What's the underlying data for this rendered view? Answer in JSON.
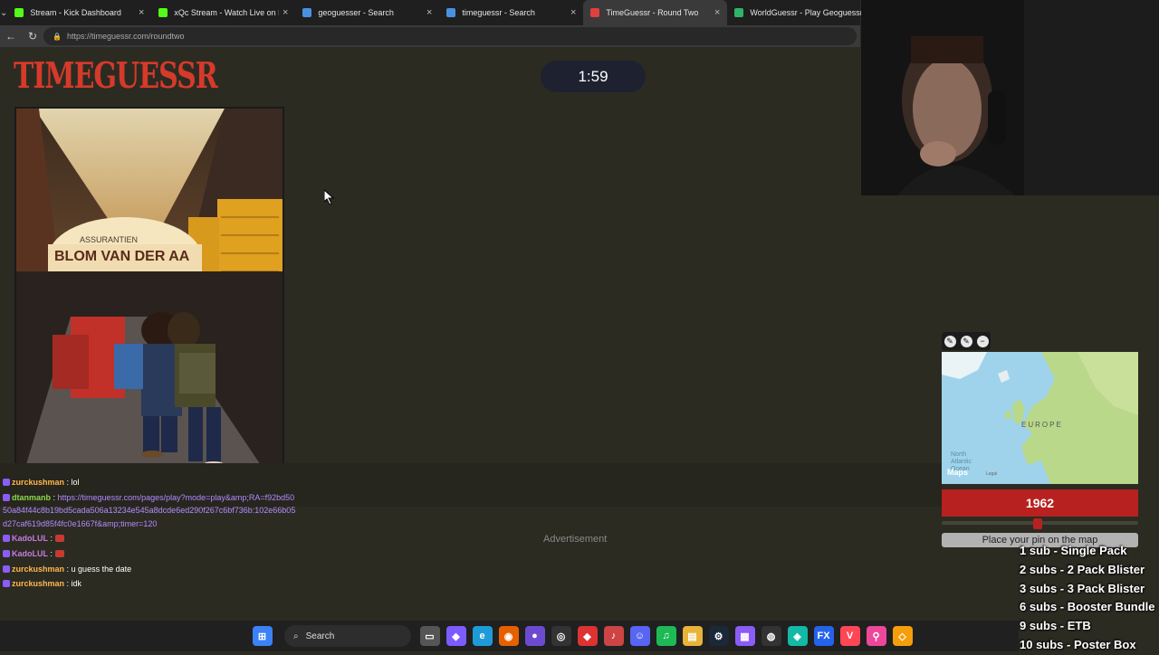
{
  "browser": {
    "tabs": [
      {
        "title": "Stream - Kick Dashboard",
        "favicon_color": "#53fc18"
      },
      {
        "title": "xQc Stream - Watch Live on Kick",
        "favicon_color": "#53fc18"
      },
      {
        "title": "geoguesser - Search",
        "favicon_color": "#4a90e2"
      },
      {
        "title": "timeguessr - Search",
        "favicon_color": "#4a90e2"
      },
      {
        "title": "TimeGuessr - Round Two",
        "favicon_color": "#e04040",
        "active": true
      },
      {
        "title": "WorldGuessr - Play Geoguessr f",
        "favicon_color": "#2fb36a"
      }
    ],
    "url": "https://timeguessr.com/roundtwo"
  },
  "game": {
    "logo": "TIMEGUESSR",
    "timer": "1:59",
    "photo_signs": [
      "ASSURANTIEN",
      "BLOM  VAN DER AA"
    ],
    "map": {
      "region_label": "EUROPE",
      "ocean_label": "North Atlantic Ocean",
      "brand": "Maps",
      "legal": "Legal",
      "tools": [
        "pencil-icon",
        "pencil-icon",
        "minus-icon"
      ]
    },
    "year": "1962",
    "slider_fraction": 0.49,
    "place_pin_text": "Place your pin on the map",
    "advertisement": "Advertisement"
  },
  "chat": [
    {
      "user": "zurckushman",
      "text": "lol",
      "color": "orange"
    },
    {
      "user": "dtanmanb",
      "link": "https://timeguessr.com/pages/play?mode=play&amp;RA=f92bd5050a84f44c8b19bd5cada506a13234e545a8dcde6ed290f267c6bf736b:102e66b05d27caf619d85f4fc0e1667f&amp;timer=120",
      "color": "green"
    },
    {
      "user": "KadoLUL",
      "text": "",
      "color": "purple",
      "emote": true
    },
    {
      "user": "KadoLUL",
      "text": "",
      "color": "purple",
      "emote": true
    },
    {
      "user": "zurckushman",
      "text": "u guess the date",
      "color": "orange"
    },
    {
      "user": "zurckushman",
      "text": "idk",
      "color": "orange"
    }
  ],
  "sub_goals": [
    "1 sub - Single Pack",
    "2 subs - 2 Pack Blister",
    "3 subs - 3 Pack Blister",
    "6 subs - Booster Bundle",
    "9 subs - ETB",
    "10 subs - Poster Box"
  ],
  "taskbar": {
    "search_label": "Search",
    "icons": [
      {
        "name": "windows-start-icon",
        "color": "#3b82f6",
        "glyph": "⊞"
      },
      {
        "name": "task-view-icon",
        "color": "#555",
        "glyph": "▭"
      },
      {
        "name": "copilot-icon",
        "color": "#7c5cff",
        "glyph": "◆"
      },
      {
        "name": "edge-icon",
        "color": "#1e9bd7",
        "glyph": "e"
      },
      {
        "name": "firefox-icon",
        "color": "#e66000",
        "glyph": "◉"
      },
      {
        "name": "app-icon",
        "color": "#6d4bd1",
        "glyph": "●"
      },
      {
        "name": "obs-icon",
        "color": "#333",
        "glyph": "◎"
      },
      {
        "name": "app-red-icon",
        "color": "#d33",
        "glyph": "◆"
      },
      {
        "name": "itunes-icon",
        "color": "#c44",
        "glyph": "♪"
      },
      {
        "name": "discord-icon",
        "color": "#5865f2",
        "glyph": "☺"
      },
      {
        "name": "spotify-icon",
        "color": "#1db954",
        "glyph": "♫"
      },
      {
        "name": "file-explorer-icon",
        "color": "#e8b339",
        "glyph": "▤"
      },
      {
        "name": "steam-icon",
        "color": "#1b2838",
        "glyph": "⚙"
      },
      {
        "name": "app-purple-icon",
        "color": "#8b5cf6",
        "glyph": "▦"
      },
      {
        "name": "app-dark-icon",
        "color": "#333",
        "glyph": "◍"
      },
      {
        "name": "app-teal-icon",
        "color": "#14b8a6",
        "glyph": "◈"
      },
      {
        "name": "fx-icon",
        "color": "#2563eb",
        "glyph": "FX"
      },
      {
        "name": "valorant-icon",
        "color": "#ff4655",
        "glyph": "V"
      },
      {
        "name": "maps-pin-icon",
        "color": "#ec4899",
        "glyph": "⚲"
      },
      {
        "name": "app-multi-icon",
        "color": "#f59e0b",
        "glyph": "◇"
      }
    ]
  }
}
